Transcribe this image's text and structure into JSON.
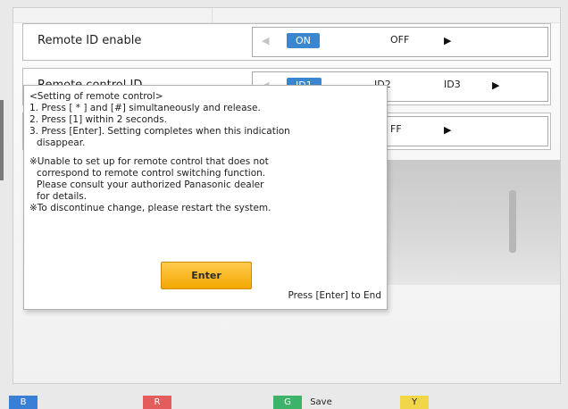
{
  "settings": {
    "remote_id_enable": {
      "label": "Remote ID enable",
      "options": [
        "ON",
        "OFF"
      ],
      "selected": "ON"
    },
    "remote_control_id": {
      "label": "Remote control ID",
      "options": [
        "ID1",
        "ID2",
        "ID3"
      ],
      "selected": "ID1"
    },
    "third_row": {
      "options_visible": [
        "FF"
      ]
    }
  },
  "dialog": {
    "title": "<Setting of remote control>",
    "steps": [
      "1. Press [ * ] and [#] simultaneously and release.",
      "2. Press [1] within 2 seconds.",
      "3. Press [Enter]. Setting completes when this indication",
      "disappear."
    ],
    "notes": [
      "※Unable to set up for remote control that does not",
      "correspond to remote control switching function.",
      "Please consult your authorized Panasonic dealer",
      "for details.",
      "※To discontinue change, please restart the system."
    ],
    "enter_button": "Enter",
    "end_hint": "Press [Enter] to End"
  },
  "bottom_keys": [
    {
      "key": "B",
      "label": "",
      "color": "#3a7fd6"
    },
    {
      "key": "R",
      "label": "",
      "color": "#e45d5d"
    },
    {
      "key": "G",
      "label": "Save",
      "color": "#3db36a"
    },
    {
      "key": "Y",
      "label": "",
      "color": "#f2d64a"
    }
  ]
}
